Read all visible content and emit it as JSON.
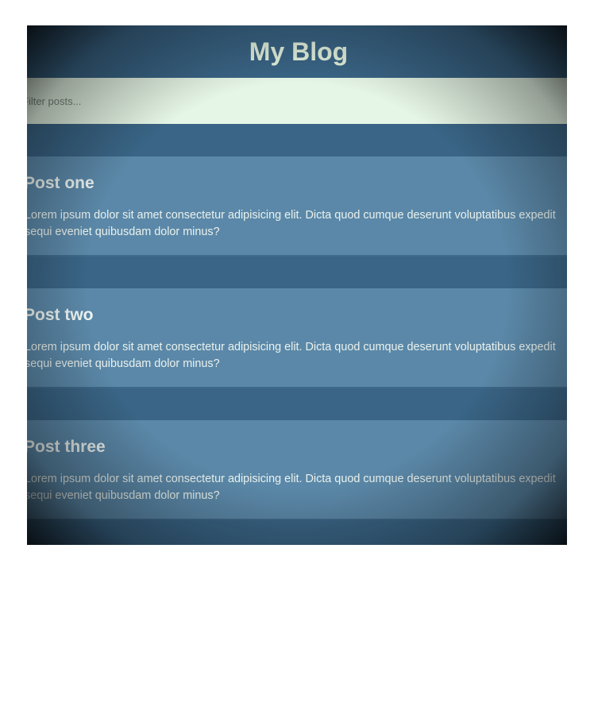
{
  "header": {
    "title": "My Blog"
  },
  "search": {
    "placeholder": "Filter posts..."
  },
  "posts": [
    {
      "title": "Post one",
      "body": "Lorem ipsum dolor sit amet consectetur adipisicing elit. Dicta quod cumque deserunt voluptatibus expedit sequi eveniet quibusdam dolor minus?"
    },
    {
      "title": "Post two",
      "body": "Lorem ipsum dolor sit amet consectetur adipisicing elit. Dicta quod cumque deserunt voluptatibus expedit sequi eveniet quibusdam dolor minus?"
    },
    {
      "title": "Post three",
      "body": "Lorem ipsum dolor sit amet consectetur adipisicing elit. Dicta quod cumque deserunt voluptatibus expedit sequi eveniet quibusdam dolor minus?"
    }
  ],
  "colors": {
    "page_background": "#3a6586",
    "post_background": "#5b88a8",
    "search_background": "#e6f6e6",
    "title_text": "#e4f3df"
  }
}
